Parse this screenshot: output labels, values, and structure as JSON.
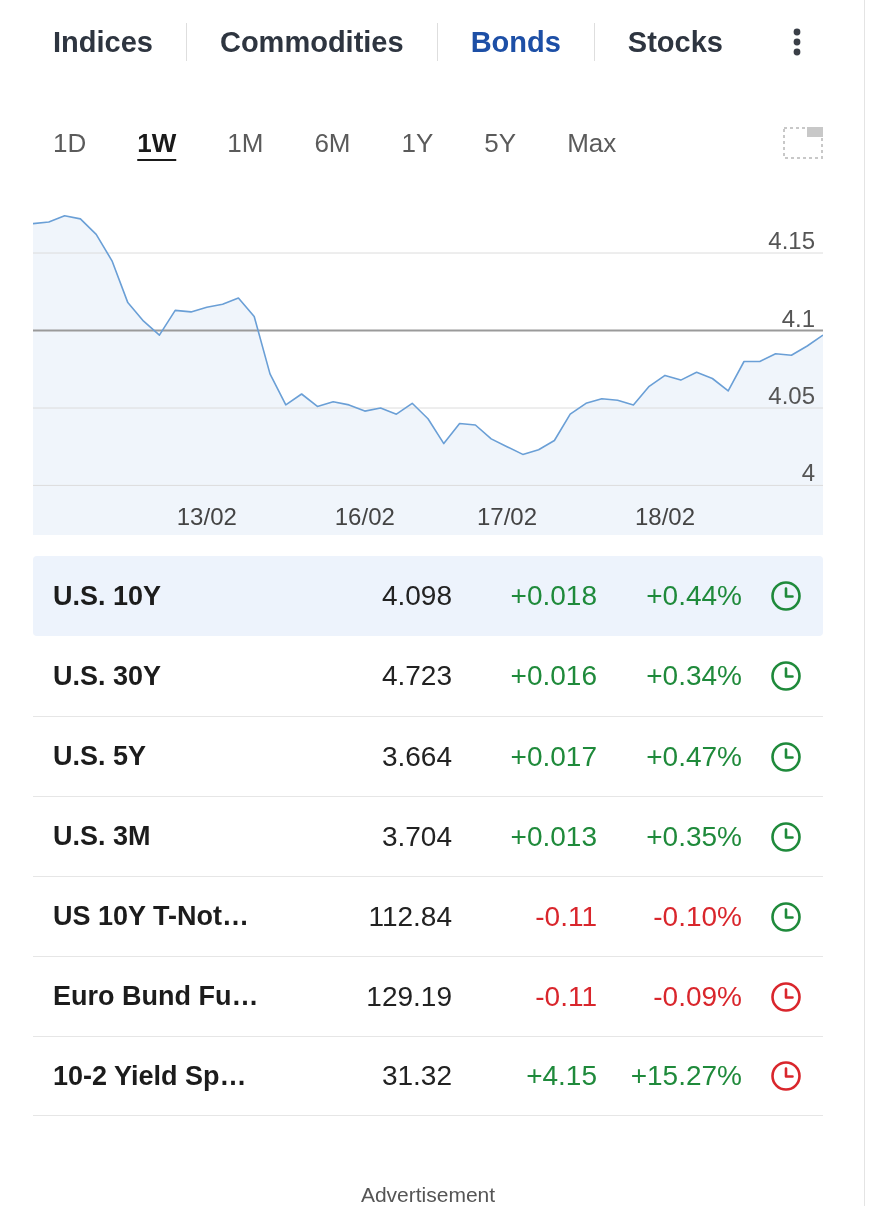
{
  "tabs": [
    {
      "label": "Indices",
      "selected": false
    },
    {
      "label": "Commodities",
      "selected": false
    },
    {
      "label": "Bonds",
      "selected": true
    },
    {
      "label": "Stocks",
      "selected": false
    }
  ],
  "ranges": [
    {
      "label": "1D",
      "selected": false
    },
    {
      "label": "1W",
      "selected": true
    },
    {
      "label": "1M",
      "selected": false
    },
    {
      "label": "6M",
      "selected": false
    },
    {
      "label": "1Y",
      "selected": false
    },
    {
      "label": "5Y",
      "selected": false
    },
    {
      "label": "Max",
      "selected": false
    }
  ],
  "chart": {
    "chart_data": {
      "type": "area",
      "grid": true,
      "ylim": [
        3.968,
        4.181
      ],
      "yticks": [
        4,
        4.05,
        4.1,
        4.15
      ],
      "categories": [
        null,
        null,
        null,
        null,
        null,
        null,
        null,
        null,
        null,
        null,
        null,
        "13/02",
        null,
        null,
        null,
        null,
        null,
        null,
        null,
        null,
        null,
        "16/02",
        null,
        null,
        null,
        null,
        null,
        null,
        null,
        null,
        "17/02",
        null,
        null,
        null,
        null,
        null,
        null,
        null,
        null,
        null,
        "18/02",
        null,
        null,
        null,
        null,
        null,
        null,
        null,
        null,
        null,
        null
      ],
      "series": [
        {
          "color": "#6a9fd6",
          "values": [
            4.169,
            4.17,
            4.174,
            4.172,
            4.162,
            4.145,
            4.118,
            4.106,
            4.097,
            4.113,
            4.112,
            4.115,
            4.117,
            4.121,
            4.109,
            4.072,
            4.052,
            4.059,
            4.051,
            4.054,
            4.052,
            4.048,
            4.05,
            4.046,
            4.053,
            4.043,
            4.027,
            4.04,
            4.039,
            4.03,
            4.025,
            4.02,
            4.023,
            4.029,
            4.046,
            4.053,
            4.056,
            4.055,
            4.052,
            4.064,
            4.071,
            4.068,
            4.073,
            4.069,
            4.061,
            4.08,
            4.08,
            4.085,
            4.084,
            4.09,
            4.097
          ]
        }
      ],
      "ref_lines": [
        {
          "axis": "y",
          "value": 4.1
        }
      ]
    }
  },
  "table": {
    "rows": [
      {
        "name": "U.S. 10Y",
        "last": "4.098",
        "change": "+0.018",
        "change_pct": "+0.44%",
        "positive": true,
        "color": "#1f8a3b",
        "selected": true
      },
      {
        "name": "U.S. 30Y",
        "last": "4.723",
        "change": "+0.016",
        "change_pct": "+0.34%",
        "positive": true,
        "color": "#1f8a3b",
        "selected": false
      },
      {
        "name": "U.S. 5Y",
        "last": "3.664",
        "change": "+0.017",
        "change_pct": "+0.47%",
        "positive": true,
        "color": "#1f8a3b",
        "selected": false
      },
      {
        "name": "U.S. 3M",
        "last": "3.704",
        "change": "+0.013",
        "change_pct": "+0.35%",
        "positive": true,
        "color": "#1f8a3b",
        "selected": false
      },
      {
        "name": "US 10Y T-Not…",
        "last": "112.84",
        "change": "-0.11",
        "change_pct": "-0.10%",
        "positive": false,
        "color": "#1f8a3b",
        "selected": false
      },
      {
        "name": "Euro Bund Fu…",
        "last": "129.19",
        "change": "-0.11",
        "change_pct": "-0.09%",
        "positive": false,
        "color": "#d9262c",
        "selected": false
      },
      {
        "name": "10-2 Yield Sp…",
        "last": "31.32",
        "change": "+4.15",
        "change_pct": "+15.27%",
        "positive": true,
        "color": "#d9262c",
        "selected": false
      }
    ]
  },
  "footer": {
    "advertisement": "Advertisement"
  }
}
